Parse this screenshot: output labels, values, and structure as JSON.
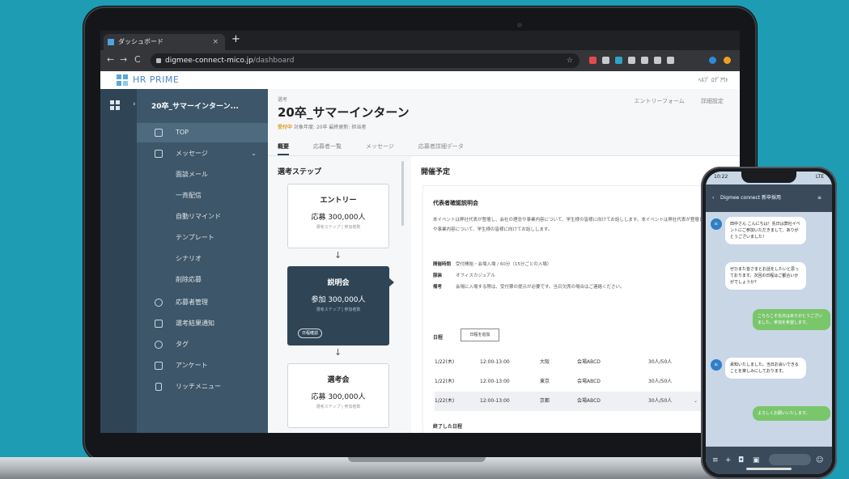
{
  "browser": {
    "tab_title": "ダッシュボード",
    "tab_close": "×",
    "new_tab": "+",
    "nav_back": "←",
    "nav_forward": "→",
    "nav_reload": "C",
    "url_domain": "digmee-connect-mico.jp",
    "url_path": "/dashboard"
  },
  "app": {
    "brand": "HR PRIME",
    "header_links": "ﾍﾙﾌﾟ  ﾛｸﾞｱｳﾄ"
  },
  "sidebar": {
    "project_title": "20卒_サマーインターン...",
    "items": [
      {
        "label": "TOP",
        "active": true,
        "icon": "home-icon"
      },
      {
        "label": "メッセージ",
        "icon": "megaphone-icon",
        "expandable": true
      },
      {
        "label": "面談メール",
        "sub": true
      },
      {
        "label": "一斉配信",
        "sub": true
      },
      {
        "label": "自動リマインド",
        "sub": true
      },
      {
        "label": "テンプレート",
        "sub": true
      },
      {
        "label": "シナリオ",
        "sub": true
      },
      {
        "label": "削除応募",
        "sub": true
      },
      {
        "label": "応募者管理",
        "icon": "users-icon"
      },
      {
        "label": "選考結果通知",
        "icon": "bell-icon"
      },
      {
        "label": "タグ",
        "icon": "tag-icon"
      },
      {
        "label": "アンケート",
        "icon": "clipboard-icon"
      },
      {
        "label": "リッチメニュー",
        "icon": "mobile-icon"
      }
    ]
  },
  "main": {
    "breadcrumb": "選考",
    "title": "20卒_サマーインターン",
    "meta_status": "受付中",
    "meta_text": "対象年度: 20卒  最終更新: 担当者",
    "top_actions": [
      "エントリーフォーム",
      "詳細設定"
    ],
    "tabs": [
      "概要",
      "応募者一覧",
      "メッセージ",
      "応募者詳細データ"
    ],
    "steps_heading": "選考ステップ",
    "steps": [
      {
        "name": "エントリー",
        "count": "応募 300,000人",
        "sub": "選考ステップ | 参加者数"
      },
      {
        "name": "説明会",
        "count": "参加 300,000人",
        "sub": "選考ステップ | 参加者数",
        "button": "日程確認"
      },
      {
        "name": "選考会",
        "count": "応募 300,000人",
        "sub": "選考ステップ | 参加者数"
      }
    ],
    "step_arrow": "↓",
    "schedule_heading": "開催予定",
    "event": {
      "title": "代表者確認説明会",
      "description": "本イベントは弊社代表が登壇し、会社の理念や事業内容について、学生様の皆様に向けてお話しします。本イベントは弊社代表が登壇し、会社の理念や事業内容について、学生様の皆様に向けてお話しします。",
      "details": [
        {
          "key": "開催時間",
          "value": "受付開始・会場入場 / 60分（15分ごとの入場）"
        },
        {
          "key": "服装",
          "value": "オフィスカジュアル"
        },
        {
          "key": "備考",
          "value": "会場に入場する際は、受付票の提示が必要です。当日欠席の場合はご連絡ください。"
        }
      ],
      "dates_label": "日程",
      "dates_button": "日程を追加",
      "rows": [
        {
          "date": "1/22(木)",
          "time": "12:00-13:00",
          "place": "大阪",
          "venue": "会場ABCD",
          "cap": "30人/50人"
        },
        {
          "date": "1/22(木)",
          "time": "12:00-13:00",
          "place": "東京",
          "venue": "会場ABCD",
          "cap": "30人/50人"
        },
        {
          "date": "1/22(木)",
          "time": "12:00-13:00",
          "place": "京都",
          "venue": "会場ABCD",
          "cap": "30人/50人"
        }
      ],
      "done_label": "終了した日程"
    }
  },
  "phone": {
    "time": "10:22",
    "signal": "LTE",
    "chat_title": "Digmee connect 新卒採用",
    "messages": [
      {
        "dir": "in",
        "text": "田中さん こんにちは！先日は弊社イベントにご参加いただきまして、ありがとうございました！"
      },
      {
        "dir": "in",
        "text": "ぜひまた皆さまとお話をしたいと思っております。次回の日程はご都合いかがでしょうか？"
      },
      {
        "dir": "out",
        "text": "こちらこそ先日はありがとうございました。参加を希望します。"
      },
      {
        "dir": "in",
        "text": "承知いたしました。当日お会いできることを楽しみにしております。"
      },
      {
        "dir": "out",
        "text": "よろしくお願いいたします。"
      }
    ]
  }
}
